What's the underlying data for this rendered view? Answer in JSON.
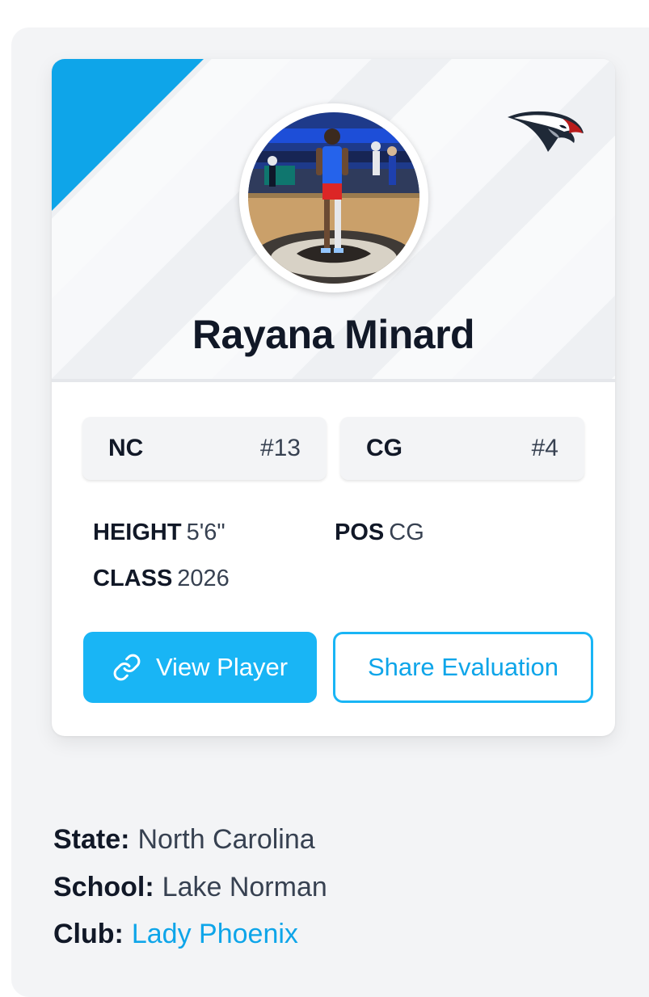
{
  "player": {
    "name": "Rayana Minard",
    "avatar_alt": "Player photo",
    "team_logo": "eagle-head-logo"
  },
  "chips": [
    {
      "label": "NC",
      "number": "#13"
    },
    {
      "label": "CG",
      "number": "#4"
    }
  ],
  "stats": {
    "height_label": "HEIGHT",
    "height_value": "5'6\"",
    "pos_label": "POS",
    "pos_value": "CG",
    "class_label": "CLASS",
    "class_value": "2026"
  },
  "buttons": {
    "view_player": "View Player",
    "view_player_icon": "link-icon",
    "share_evaluation": "Share Evaluation"
  },
  "info": {
    "state_label": "State:",
    "state_value": "North Carolina",
    "school_label": "School:",
    "school_value": "Lake Norman",
    "club_label": "Club:",
    "club_value": "Lady Phoenix"
  },
  "colors": {
    "accent": "#19b5f5",
    "corner": "#0ea5e9",
    "text_dark": "#111827",
    "chip_bg": "#f3f4f6",
    "logo_red": "#b91c1c"
  }
}
